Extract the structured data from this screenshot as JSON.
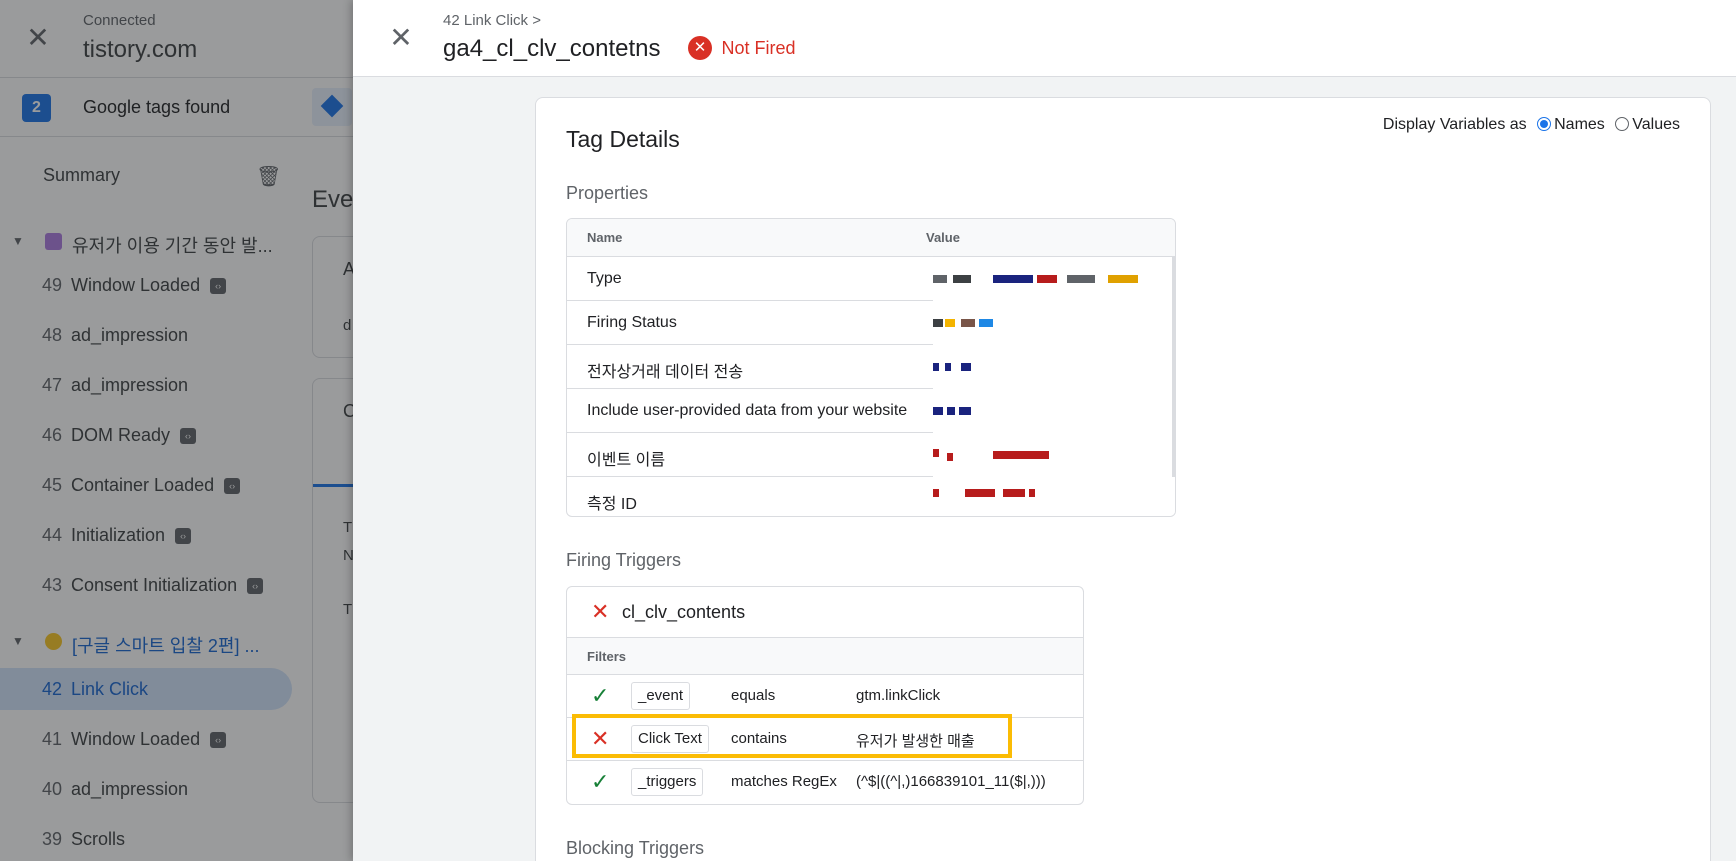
{
  "background": {
    "connected_label": "Connected",
    "domain": "tistory.com",
    "tags_count": "2",
    "tags_found_label": "Google tags found",
    "summary_label": "Summary",
    "event_title_partial": "Eve",
    "card1_letter": "A",
    "card1_sub": "d",
    "card2_letter": "C",
    "card2_t1": "T",
    "card2_n": "N",
    "card2_t2": "T",
    "sidebar": {
      "group1": "유저가 이용 기간 동안 발...",
      "group2": "[구글 스마트 입찰 2편] ...",
      "items": [
        {
          "num": "49",
          "label": "Window Loaded",
          "badge": true
        },
        {
          "num": "48",
          "label": "ad_impression",
          "badge": false
        },
        {
          "num": "47",
          "label": "ad_impression",
          "badge": false
        },
        {
          "num": "46",
          "label": "DOM Ready",
          "badge": true
        },
        {
          "num": "45",
          "label": "Container Loaded",
          "badge": true
        },
        {
          "num": "44",
          "label": "Initialization",
          "badge": true
        },
        {
          "num": "43",
          "label": "Consent Initialization",
          "badge": true
        },
        {
          "num": "42",
          "label": "Link Click",
          "badge": false
        },
        {
          "num": "41",
          "label": "Window Loaded",
          "badge": true
        },
        {
          "num": "40",
          "label": "ad_impression",
          "badge": false
        },
        {
          "num": "39",
          "label": "Scrolls",
          "badge": false
        }
      ]
    }
  },
  "panel": {
    "breadcrumb": "42 Link Click >",
    "title": "ga4_cl_clv_contetns",
    "status": "Not Fired",
    "card_title": "Tag Details",
    "display_vars_label": "Display Variables as",
    "display_vars_names": "Names",
    "display_vars_values": "Values",
    "properties_title": "Properties",
    "props_head_name": "Name",
    "props_head_value": "Value",
    "properties": [
      "Type",
      "Firing Status",
      "전자상거래 데이터 전송",
      "Include user-provided data from your website",
      "이벤트 이름",
      "측정 ID"
    ],
    "firing_triggers_title": "Firing Triggers",
    "trigger_name": "cl_clv_contents",
    "filters_label": "Filters",
    "filters": [
      {
        "status": "ok",
        "variable": "_event",
        "operator": "equals",
        "value": "gtm.linkClick"
      },
      {
        "status": "bad",
        "variable": "Click Text",
        "operator": "contains",
        "value": "유저가 발생한 매출"
      },
      {
        "status": "ok",
        "variable": "_triggers",
        "operator": "matches RegEx",
        "value": "(^$|((^|,)166839101_11($|,)))"
      }
    ],
    "blocking_triggers_title": "Blocking Triggers"
  },
  "icons": {
    "close": "close-icon",
    "error": "error-circle-icon",
    "check": "check-icon",
    "cross": "cross-icon",
    "trash": "clear-list-icon",
    "tag_diamond": "tag-diamond-icon"
  },
  "colors": {
    "accent": "#1a73e8",
    "error": "#d93025",
    "success": "#188038",
    "highlight": "#fbbc04"
  }
}
